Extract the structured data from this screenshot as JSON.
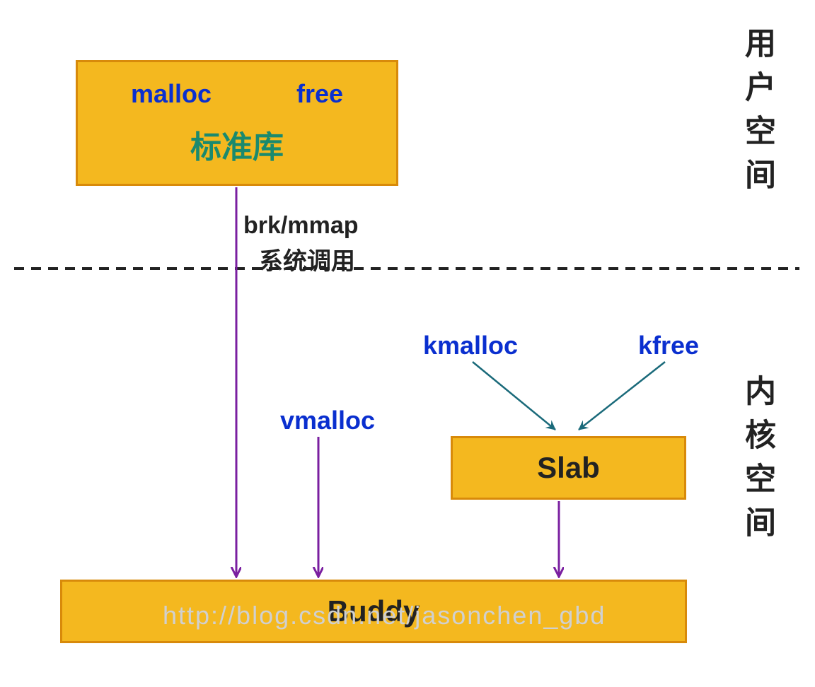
{
  "boxes": {
    "stdlib": {
      "malloc": "malloc",
      "free": "free",
      "title": "标准库"
    },
    "slab": {
      "title": "Slab"
    },
    "buddy": {
      "title": "Buddy"
    }
  },
  "labels": {
    "brk_mmap": "brk/mmap",
    "syscall": "系统调用",
    "vmalloc": "vmalloc",
    "kmalloc": "kmalloc",
    "kfree": "kfree"
  },
  "regions": {
    "user_space": "用户空间",
    "kernel_space": "内核空间"
  },
  "watermark": "http://blog.csdn.net/jasonchen_gbd"
}
